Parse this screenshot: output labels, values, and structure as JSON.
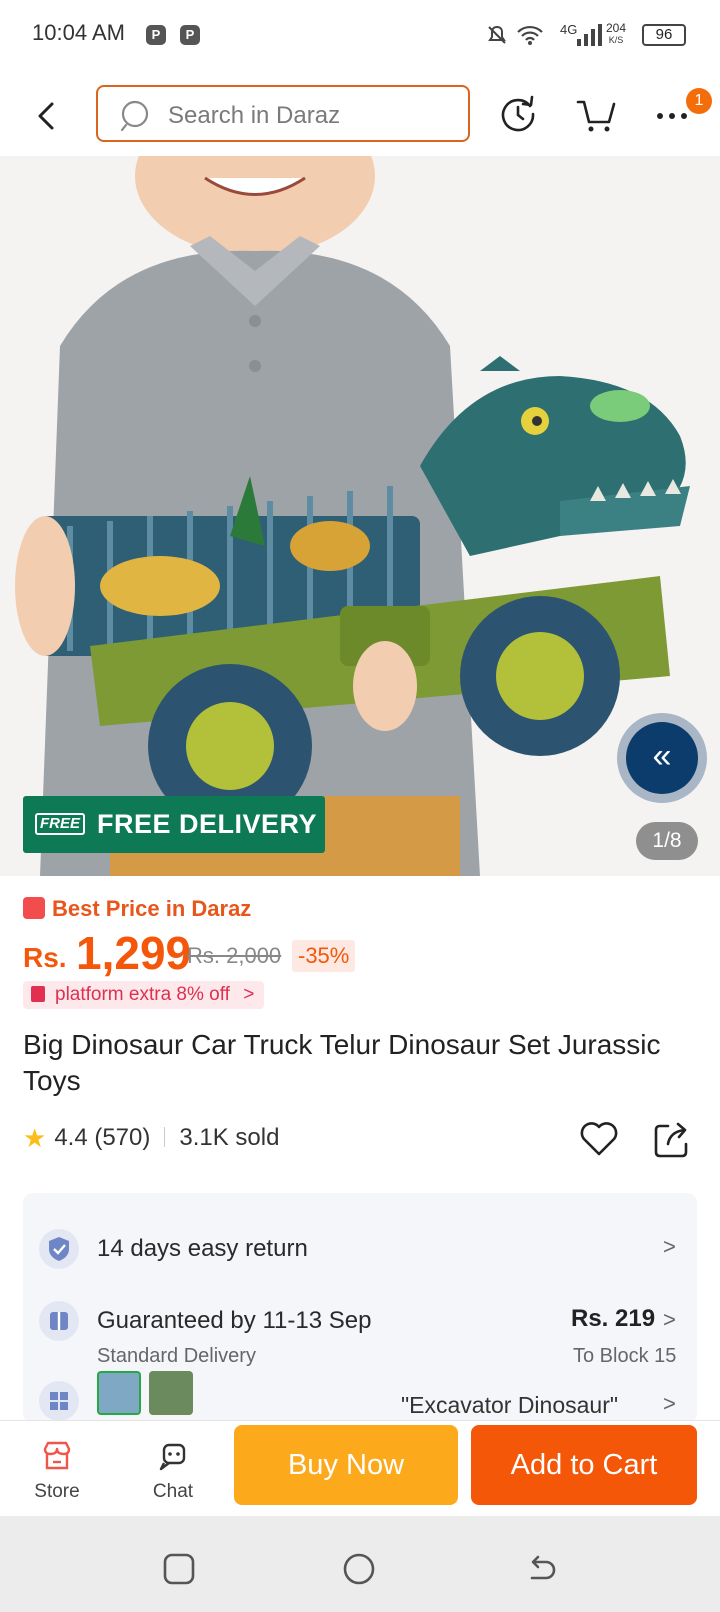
{
  "status_bar": {
    "time": "10:04 AM",
    "network": "4G",
    "speed_value": "204",
    "speed_unit": "K/S",
    "battery": "96",
    "app_icon_label": "P"
  },
  "top_bar": {
    "search_placeholder": "Search in Daraz",
    "notification_count": "1"
  },
  "hero": {
    "free_delivery_logo": "FREE",
    "free_delivery_label": "FREE DELIVERY",
    "collapse_glyph": "«",
    "image_counter": "1/8"
  },
  "product": {
    "best_price_label": "Best Price in Daraz",
    "currency": "Rs.",
    "price": "1,299",
    "original_price": "Rs. 2,000",
    "discount": "-35%",
    "promo": "platform extra 8% off",
    "promo_chevron": ">",
    "title": "Big Dinosaur Car Truck Telur Dinosaur Set Jurassic Toys",
    "star": "★",
    "rating": "4.4 (570)",
    "sold": "3.1K sold"
  },
  "info_card": {
    "return_text": "14 days easy return",
    "delivery_text": "Guaranteed by 11-13 Sep",
    "delivery_sub": "Standard Delivery",
    "delivery_price": "Rs. 219",
    "delivery_location": "To Block 15",
    "variant_text": "\"Excavator Dinosaur\"",
    "chevron": ">"
  },
  "bottom_bar": {
    "store_label": "Store",
    "chat_label": "Chat",
    "buy_now_label": "Buy Now",
    "add_to_cart_label": "Add to Cart"
  },
  "colors": {
    "accent_orange": "#f4560a",
    "buy_now": "#fda91c",
    "free_delivery_green": "#0d7a55",
    "search_border": "#d9651f"
  }
}
